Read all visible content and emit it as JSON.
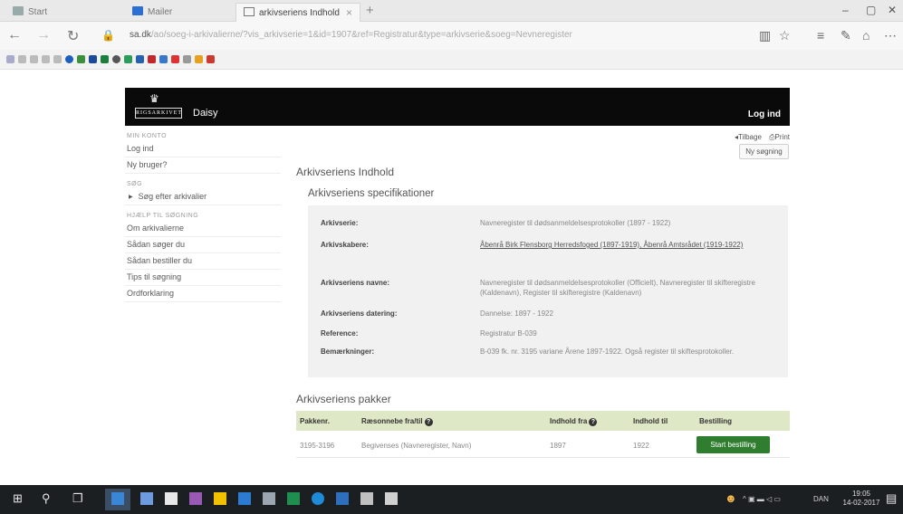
{
  "browser": {
    "tabs": [
      {
        "label": "Start"
      },
      {
        "label": "Mailer"
      },
      {
        "label": "arkivseriens Indhold"
      }
    ],
    "url_host": "sa.dk",
    "url_rest": "/ao/soeg-i-arkivalierne/?vis_arkivserie=1&id=1907&ref=Registratur&type=arkivserie&soeg=Nevneregister",
    "window_controls": [
      "–",
      "▢",
      "✕"
    ],
    "nav": {
      "back": "←",
      "forward": "→",
      "refresh": "↻"
    }
  },
  "header": {
    "crown": "♛",
    "logo_text": "RIGSARKIVET",
    "app_name": "Daisy",
    "logout": "Log ind"
  },
  "sidebar": {
    "section1_heading": "Min konto",
    "section1_items": [
      "Log ind",
      "Ny bruger?"
    ],
    "section2_heading": "Søg",
    "section2_items": [
      "Søg efter arkivalier"
    ],
    "section3_heading": "Hjælp til søgning",
    "section3_items": [
      "Om arkivalierne",
      "Sådan søger du",
      "Sådan bestiller du",
      "Tips til søgning",
      "Ordforklaring"
    ]
  },
  "toplinks": {
    "back": "◂Tilbage",
    "print": "⎙Print"
  },
  "new_search": "Ny søgning",
  "page_title": "Arkivseriens Indhold",
  "spec_title": "Arkivseriens specifikationer",
  "spec": [
    {
      "label": "Arkivserie:",
      "value": "Navneregister til dødsanmeldelsesprotokoller (1897 - 1922)",
      "link": false
    },
    {
      "label": "Arkivskabere:",
      "value": "Åbenrå Birk Flensborg Herredsfoged (1897-1919), Åbenrå Amtsrådet (1919-1922)",
      "link": true
    },
    {
      "label": "Arkivseriens navne:",
      "value": "Navneregister til dødsanmeldelsesprotokoller (Officielt), Navneregister til skifteregistre (Kaldenavn), Register til skifteregistre (Kaldenavn)",
      "link": false
    },
    {
      "label": "Arkivseriens datering:",
      "value": "Dannelse: 1897 - 1922",
      "link": false
    },
    {
      "label": "Reference:",
      "value": "Registratur B-039",
      "link": false
    },
    {
      "label": "Bemærkninger:",
      "value": "B-039 fk. nr. 3195 variane Årene 1897-1922. Også register til skiftesprotokoller.",
      "link": false
    }
  ],
  "packages_title": "Arkivseriens pakker",
  "packages_table": {
    "headers": [
      "Pakkenr.",
      "Ræsonnebe fra/til",
      "Indhold fra",
      "Indhold til",
      "Bestilling"
    ],
    "rows": [
      {
        "nr": "3195-3196",
        "range": "Begivenses (Navneregister, Navn)",
        "from": "1897",
        "to": "1922",
        "button": "Start bestilling"
      }
    ]
  },
  "taskbar": {
    "clock_time": "19:05",
    "clock_date": "14-02-2017",
    "tray": "DAN"
  },
  "colors": {
    "header_bg": "#0a0a0a",
    "table_header_bg": "#dfe8c6",
    "order_button": "#2f7d2f",
    "spec_panel_bg": "#f1f1f1"
  }
}
